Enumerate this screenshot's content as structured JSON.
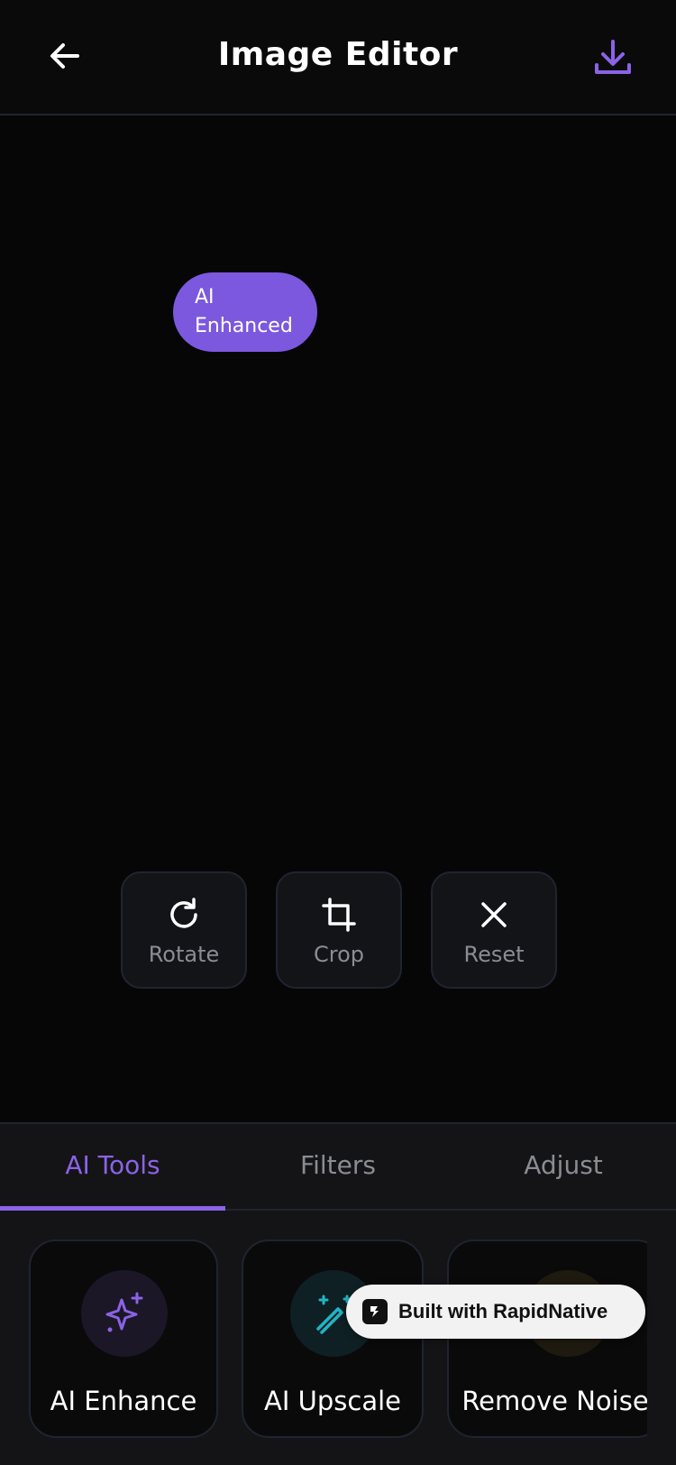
{
  "header": {
    "title": "Image Editor",
    "back_icon": "arrow-left-icon",
    "download_icon": "download-icon"
  },
  "canvas": {
    "badge_label": "AI Enhanced"
  },
  "tools": [
    {
      "label": "Rotate",
      "icon": "rotate-icon"
    },
    {
      "label": "Crop",
      "icon": "crop-icon"
    },
    {
      "label": "Reset",
      "icon": "close-icon"
    }
  ],
  "tabs": [
    {
      "label": "AI Tools",
      "active": true
    },
    {
      "label": "Filters",
      "active": false
    },
    {
      "label": "Adjust",
      "active": false
    }
  ],
  "ai_tools": [
    {
      "label": "AI Enhance",
      "icon": "sparkle-icon",
      "color": "#8b63e6"
    },
    {
      "label": "AI Upscale",
      "icon": "magic-wand-icon",
      "color": "#1fb5c8"
    },
    {
      "label": "Remove Noise",
      "icon": "noise-icon",
      "color": "#e0a100"
    }
  ],
  "built_with": {
    "label": "Built with RapidNative"
  },
  "colors": {
    "accent": "#8b63e6",
    "badge": "#7c58de",
    "background": "#0a0a0b",
    "muted_text": "#8a8c93",
    "border": "#1f2430"
  }
}
